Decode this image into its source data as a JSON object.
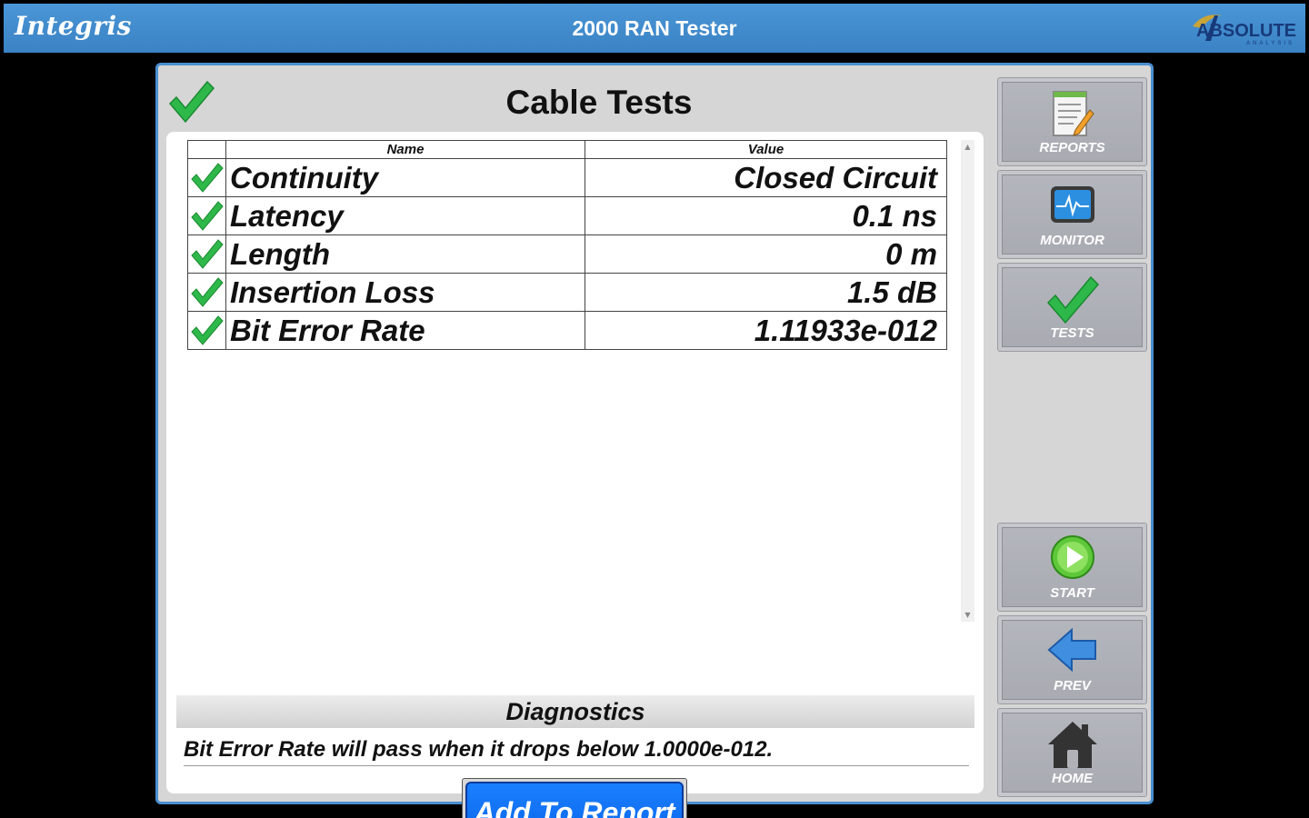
{
  "titlebar": {
    "brand_left": "Integris",
    "title": "2000 RAN Tester",
    "brand_right": "ABSOLUTE",
    "brand_right_sub": "ANALYSIS"
  },
  "page": {
    "title": "Cable Tests",
    "status_icon": "check-icon"
  },
  "table": {
    "headers": {
      "name": "Name",
      "value": "Value"
    },
    "rows": [
      {
        "status": "pass",
        "name": "Continuity",
        "value": "Closed Circuit"
      },
      {
        "status": "pass",
        "name": "Latency",
        "value": "0.1 ns"
      },
      {
        "status": "pass",
        "name": "Length",
        "value": "0 m"
      },
      {
        "status": "pass",
        "name": "Insertion Loss",
        "value": "1.5 dB"
      },
      {
        "status": "pass",
        "name": "Bit Error Rate",
        "value": "1.11933e-012"
      }
    ]
  },
  "diagnostics": {
    "title": "Diagnostics",
    "message": "Bit Error Rate will pass when it drops below 1.0000e-012."
  },
  "actions": {
    "add_to_report": "Add To Report"
  },
  "sidebar": {
    "reports": "REPORTS",
    "monitor": "MONITOR",
    "tests": "TESTS",
    "start": "START",
    "prev": "PREV",
    "home": "HOME"
  },
  "colors": {
    "titlebar": "#3a82c4",
    "check": "#2eb84a",
    "button": "#0a64e8",
    "frame_border": "#4a8fd0"
  }
}
